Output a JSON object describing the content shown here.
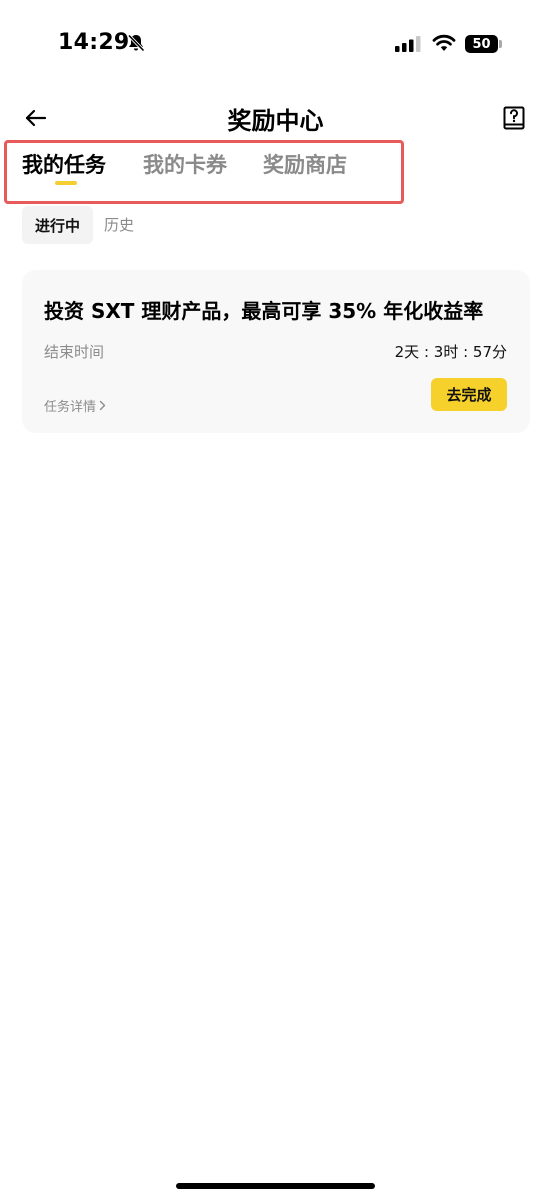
{
  "status_bar": {
    "time": "14:29",
    "battery": "50"
  },
  "header": {
    "title": "奖励中心"
  },
  "tabs": [
    {
      "label": "我的任务",
      "active": true
    },
    {
      "label": "我的卡券",
      "active": false
    },
    {
      "label": "奖励商店",
      "active": false
    }
  ],
  "subtabs": [
    {
      "label": "进行中",
      "active": true
    },
    {
      "label": "历史",
      "active": false
    }
  ],
  "task_card": {
    "title": "投资 SXT 理财产品，最高可享 35% 年化收益率",
    "end_label": "结束时间",
    "countdown": "2天 : 3时 : 57分",
    "detail_link": "任务详情",
    "action_button": "去完成"
  },
  "colors": {
    "accent": "#f6d12c",
    "highlight_border": "#e85b5b"
  }
}
